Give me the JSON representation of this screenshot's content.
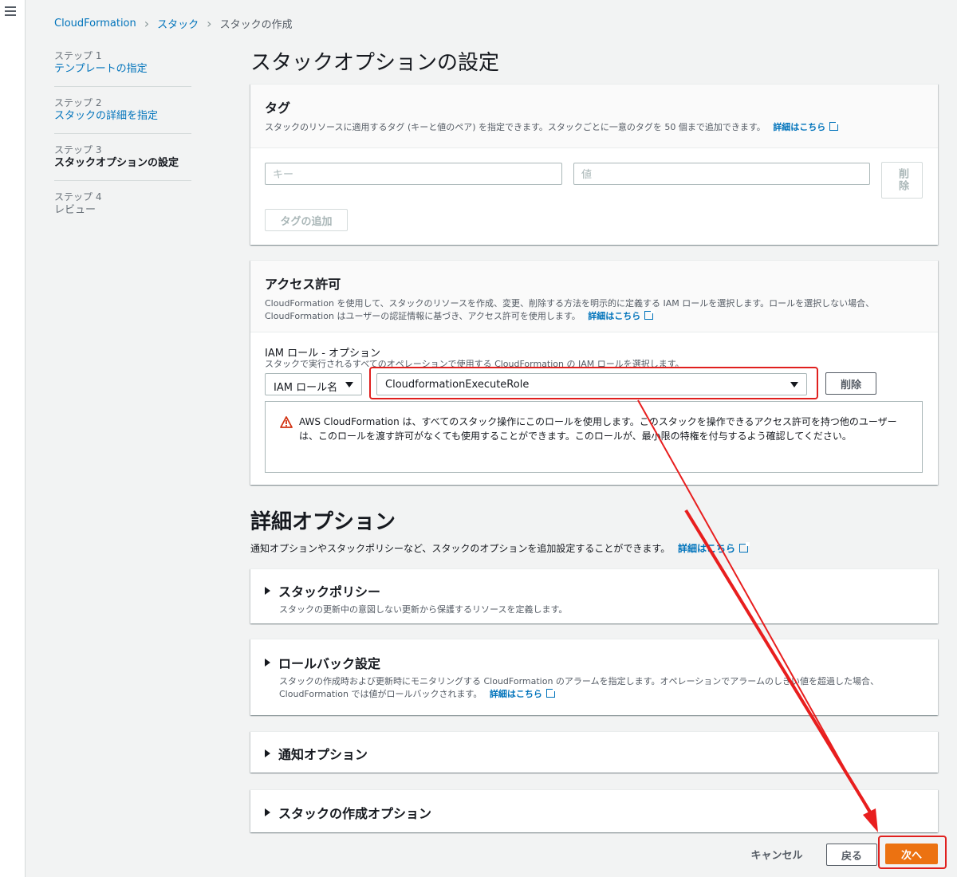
{
  "breadcrumb": {
    "items": [
      "CloudFormation",
      "スタック",
      "スタックの作成"
    ]
  },
  "steps": [
    {
      "num": "ステップ 1",
      "label": "テンプレートの指定"
    },
    {
      "num": "ステップ 2",
      "label": "スタックの詳細を指定"
    },
    {
      "num": "ステップ 3",
      "label": "スタックオプションの設定"
    },
    {
      "num": "ステップ 4",
      "label": "レビュー"
    }
  ],
  "page_title": "スタックオプションの設定",
  "tags": {
    "title": "タグ",
    "desc": "スタックのリソースに適用するタグ (キーと値のペア) を指定できます。スタックごとに一意のタグを 50 個まで追加できます。",
    "link": "詳細はこちら",
    "key_placeholder": "キー",
    "value_placeholder": "値",
    "remove_label": "削除",
    "add_label": "タグの追加"
  },
  "permissions": {
    "title": "アクセス許可",
    "desc_line1": "CloudFormation を使用して、スタックのリソースを作成、変更、削除する方法を明示的に定義する IAM ロールを選択します。ロールを選択しない場合、",
    "desc_line2": "CloudFormation はユーザーの認証情報に基づき、アクセス許可を使用します。",
    "link": "詳細はこちら",
    "field_label": "IAM ロール - オプション",
    "field_desc": "スタックで実行されるすべてのオペレーションで使用する CloudFormation の IAM ロールを選択します。",
    "type_select": "IAM ロール名",
    "role_value": "CloudformationExecuteRole",
    "remove_label": "削除",
    "warning": "AWS CloudFormation は、すべてのスタック操作にこのロールを使用します。このスタックを操作できるアクセス許可を持つ他のユーザーは、このロールを渡す許可がなくても使用することができます。このロールが、最小限の特権を付与するよう確認してください。"
  },
  "advanced": {
    "title": "詳細オプション",
    "desc": "通知オプションやスタックポリシーなど、スタックのオプションを追加設定することができます。",
    "link": "詳細はこちら",
    "sections": [
      {
        "title": "スタックポリシー",
        "desc": "スタックの更新中の意図しない更新から保護するリソースを定義します。"
      },
      {
        "title": "ロールバック設定",
        "desc_line1": "スタックの作成時および更新時にモニタリングする CloudFormation のアラームを指定します。オペレーションでアラームのしきい値を超過した場合、",
        "desc_line2": "CloudFormation では値がロールバックされます。",
        "link": "詳細はこちら"
      },
      {
        "title": "通知オプション"
      },
      {
        "title": "スタックの作成オプション"
      }
    ]
  },
  "footer": {
    "cancel": "キャンセル",
    "back": "戻る",
    "next": "次へ"
  },
  "colors": {
    "accent": "#ec7211",
    "link": "#0073bb",
    "highlight": "#e0201e"
  }
}
